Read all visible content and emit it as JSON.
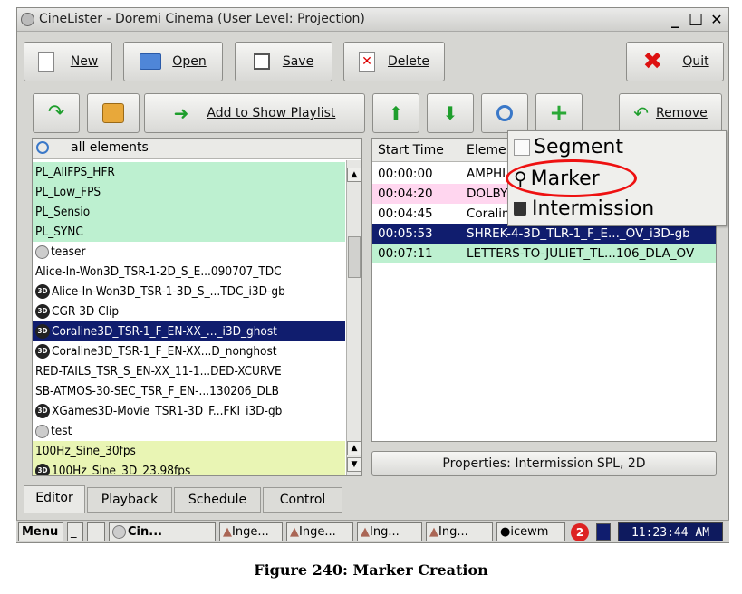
{
  "window": {
    "title": "CineLister - Doremi Cinema (User Level: Projection)",
    "minimize_glyph": "_",
    "maximize_glyph": "□",
    "close_glyph": "✕"
  },
  "toolbar": {
    "new_label": "New",
    "open_label": "Open",
    "save_label": "Save",
    "delete_label": "Delete",
    "quit_label": "Quit",
    "add_to_playlist_label": "Add to Show Playlist",
    "remove_label": "Remove"
  },
  "icons": {
    "new": "new-document-icon",
    "open": "open-folder-icon",
    "save": "floppy-disk-icon",
    "delete": "delete-x-icon",
    "quit": "red-x-icon",
    "refresh": "green-curved-arrow-icon",
    "package_delete": "package-delete-icon",
    "arrow_right": "green-right-arrow-icon",
    "move_up": "green-up-arrow-icon",
    "move_down": "green-down-arrow-icon",
    "search": "magnifier-icon",
    "add": "green-plus-icon",
    "remove": "green-back-arrow-icon"
  },
  "colors": {
    "selected": "#101d6e",
    "green_row": "#bdf0d0",
    "yellow_row": "#e9f5b4",
    "pink_row": "#ffd6ef",
    "highlight_circle": "#e11111"
  },
  "element_list": {
    "search_label": "all elements",
    "items": [
      {
        "label": "PL_AllFPS_HFR",
        "style": "green",
        "icon": ""
      },
      {
        "label": "PL_Low_FPS",
        "style": "green",
        "icon": ""
      },
      {
        "label": "PL_Sensio",
        "style": "green",
        "icon": ""
      },
      {
        "label": "PL_SYNC",
        "style": "green",
        "icon": ""
      },
      {
        "label": "teaser",
        "style": "white",
        "icon": "reel"
      },
      {
        "label": "Alice-In-Won3D_TSR-1-2D_S_E...090707_TDC",
        "style": "white",
        "icon": ""
      },
      {
        "label": "Alice-In-Won3D_TSR-1-3D_S_...TDC_i3D-gb",
        "style": "white",
        "icon": "3d"
      },
      {
        "label": "CGR 3D Clip",
        "style": "white",
        "icon": "3d"
      },
      {
        "label": "Coraline3D_TSR-1_F_EN-XX_..._i3D_ghost",
        "style": "sel",
        "icon": "3d"
      },
      {
        "label": "Coraline3D_TSR-1_F_EN-XX...D_nonghost",
        "style": "white",
        "icon": "3d"
      },
      {
        "label": "RED-TAILS_TSR_S_EN-XX_11-1...DED-XCURVE",
        "style": "white",
        "icon": ""
      },
      {
        "label": "SB-ATMOS-30-SEC_TSR_F_EN-...130206_DLB",
        "style": "white",
        "icon": ""
      },
      {
        "label": "XGames3D-Movie_TSR1-3D_F...FKI_i3D-gb",
        "style": "white",
        "icon": "3d"
      },
      {
        "label": "test",
        "style": "white",
        "icon": "reel"
      },
      {
        "label": "100Hz_Sine_30fps",
        "style": "yellow",
        "icon": ""
      },
      {
        "label": "100Hz_Sine_3D_23.98fps",
        "style": "yellow",
        "icon": "3d"
      }
    ]
  },
  "playlist": {
    "col_start": "Start Time",
    "col_element": "Eleme",
    "rows": [
      {
        "time": "00:00:00",
        "element": "AMPHI",
        "style": "white"
      },
      {
        "time": "00:04:20",
        "element": "DOLBY",
        "style": "pink"
      },
      {
        "time": "00:04:45",
        "element": "Coralin",
        "style": "white"
      },
      {
        "time": "00:05:53",
        "element": "SHREK-4-3D_TLR-1_F_E..._OV_i3D-gb",
        "style": "sel"
      },
      {
        "time": "00:07:11",
        "element": "LETTERS-TO-JULIET_TL...106_DLA_OV",
        "style": "green"
      }
    ],
    "properties": "Properties: Intermission SPL, 2D"
  },
  "context_menu": {
    "items": [
      "Segment",
      "Marker",
      "Intermission"
    ]
  },
  "tabs": [
    "Editor",
    "Playback",
    "Schedule",
    "Control"
  ],
  "taskbar": {
    "menu": "Menu",
    "apps": [
      "Cin...",
      "Inge...",
      "Inge...",
      "Ing...",
      "Ing...",
      "icewm"
    ],
    "badge": "2",
    "clock": "11:23:44 AM"
  },
  "caption": "Figure 240: Marker Creation"
}
